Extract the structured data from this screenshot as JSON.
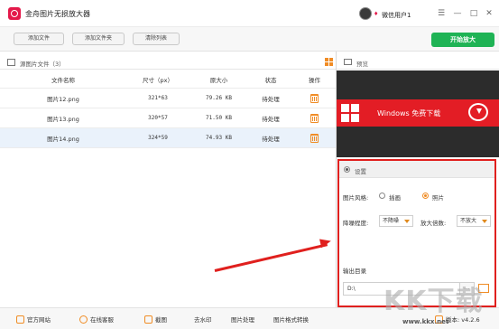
{
  "app": {
    "title": "金舟图片无损放大器"
  },
  "user": {
    "name": "微信用户1"
  },
  "window": {
    "menu": "☰",
    "minimize": "—",
    "maximize": "□",
    "close": "✕"
  },
  "toolbar": {
    "add_file": "添加文件",
    "add_folder": "添加文件夹",
    "clear_list": "清除列表",
    "start": "开始放大"
  },
  "file_list": {
    "header": "源图片文件（3）",
    "columns": [
      "文件名称",
      "尺寸（px）",
      "原大小",
      "状态",
      "操作"
    ],
    "rows": [
      {
        "name": "图片12.png",
        "size": "321*63",
        "filesize": "79.26 KB",
        "status": "待处理",
        "selected": false
      },
      {
        "name": "图片13.png",
        "size": "320*57",
        "filesize": "71.50 KB",
        "status": "待处理",
        "selected": false
      },
      {
        "name": "图片14.png",
        "size": "324*59",
        "filesize": "74.93 KB",
        "status": "待处理",
        "selected": true
      }
    ]
  },
  "preview": {
    "header": "预览",
    "banner_text": "Windows  免费下载"
  },
  "settings": {
    "header": "设置",
    "style_label": "图片风格:",
    "style_options": [
      "插画",
      "照片"
    ],
    "style_selected": "照片",
    "denoise_label": "降噪程度:",
    "denoise_value": "不降噪",
    "scale_label": "放大倍数:",
    "scale_value": "不放大",
    "output_label": "输出目录",
    "output_value": "D:\\",
    "browse_label": "..."
  },
  "statusbar": {
    "website": "官方网站",
    "support": "在线客服",
    "screenshot": "截图",
    "watermark_remove": "去水印",
    "image_process": "图片处理",
    "format_convert": "图片格式转换",
    "version": "版本: v4.2.6"
  },
  "watermark": {
    "logo": "KK下载",
    "url": "www.kkx.net"
  },
  "colors": {
    "accent_green": "#1fb355",
    "accent_orange": "#f08c25",
    "highlight_red": "#e0201e"
  }
}
